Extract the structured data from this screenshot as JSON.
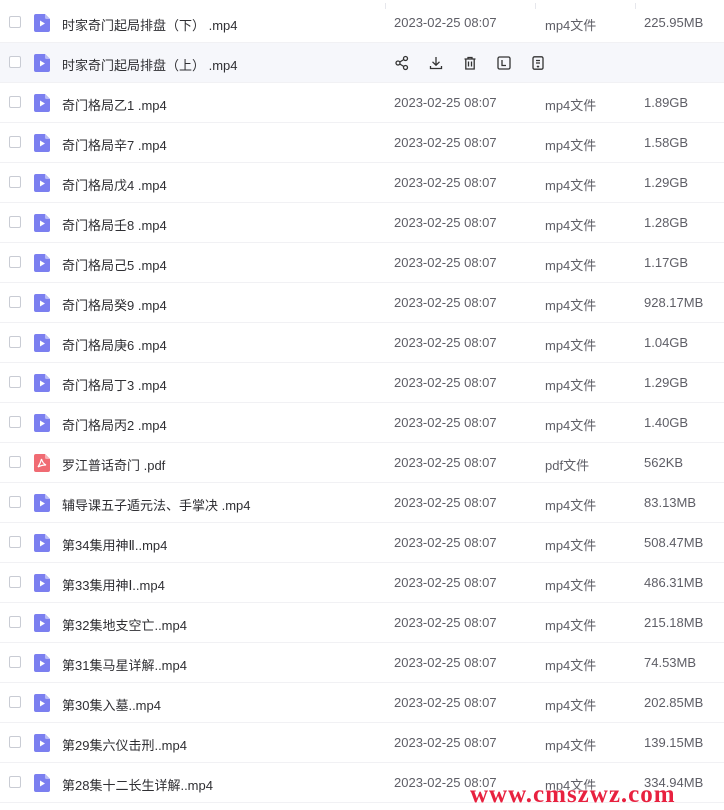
{
  "files": [
    {
      "name": "时家奇门起局排盘（下） .mp4",
      "date": "2023-02-25 08:07",
      "type": "mp4文件",
      "size": "225.95MB",
      "icon": "video-file-icon"
    },
    {
      "name": "时家奇门起局排盘（上） .mp4",
      "date": "",
      "type": "",
      "size": "",
      "icon": "video-file-icon",
      "hovered": true
    },
    {
      "name": "奇门格局乙1 .mp4",
      "date": "2023-02-25 08:07",
      "type": "mp4文件",
      "size": "1.89GB",
      "icon": "video-file-icon"
    },
    {
      "name": "奇门格局辛7 .mp4",
      "date": "2023-02-25 08:07",
      "type": "mp4文件",
      "size": "1.58GB",
      "icon": "video-file-icon"
    },
    {
      "name": "奇门格局戊4 .mp4",
      "date": "2023-02-25 08:07",
      "type": "mp4文件",
      "size": "1.29GB",
      "icon": "video-file-icon"
    },
    {
      "name": "奇门格局壬8 .mp4",
      "date": "2023-02-25 08:07",
      "type": "mp4文件",
      "size": "1.28GB",
      "icon": "video-file-icon"
    },
    {
      "name": "奇门格局己5 .mp4",
      "date": "2023-02-25 08:07",
      "type": "mp4文件",
      "size": "1.17GB",
      "icon": "video-file-icon"
    },
    {
      "name": "奇门格局癸9 .mp4",
      "date": "2023-02-25 08:07",
      "type": "mp4文件",
      "size": "928.17MB",
      "icon": "video-file-icon"
    },
    {
      "name": "奇门格局庚6 .mp4",
      "date": "2023-02-25 08:07",
      "type": "mp4文件",
      "size": "1.04GB",
      "icon": "video-file-icon"
    },
    {
      "name": "奇门格局丁3 .mp4",
      "date": "2023-02-25 08:07",
      "type": "mp4文件",
      "size": "1.29GB",
      "icon": "video-file-icon"
    },
    {
      "name": "奇门格局丙2 .mp4",
      "date": "2023-02-25 08:07",
      "type": "mp4文件",
      "size": "1.40GB",
      "icon": "video-file-icon"
    },
    {
      "name": "罗江普话奇门 .pdf",
      "date": "2023-02-25 08:07",
      "type": "pdf文件",
      "size": "562KB",
      "icon": "pdf-file-icon"
    },
    {
      "name": "辅导课五子遁元法、手掌决 .mp4",
      "date": "2023-02-25 08:07",
      "type": "mp4文件",
      "size": "83.13MB",
      "icon": "video-file-icon"
    },
    {
      "name": "第34集用神Ⅱ..mp4",
      "date": "2023-02-25 08:07",
      "type": "mp4文件",
      "size": "508.47MB",
      "icon": "video-file-icon"
    },
    {
      "name": "第33集用神Ⅰ..mp4",
      "date": "2023-02-25 08:07",
      "type": "mp4文件",
      "size": "486.31MB",
      "icon": "video-file-icon"
    },
    {
      "name": "第32集地支空亡..mp4",
      "date": "2023-02-25 08:07",
      "type": "mp4文件",
      "size": "215.18MB",
      "icon": "video-file-icon"
    },
    {
      "name": "第31集马星详解..mp4",
      "date": "2023-02-25 08:07",
      "type": "mp4文件",
      "size": "74.53MB",
      "icon": "video-file-icon"
    },
    {
      "name": "第30集入墓..mp4",
      "date": "2023-02-25 08:07",
      "type": "mp4文件",
      "size": "202.85MB",
      "icon": "video-file-icon"
    },
    {
      "name": "第29集六仪击刑..mp4",
      "date": "2023-02-25 08:07",
      "type": "mp4文件",
      "size": "139.15MB",
      "icon": "video-file-icon"
    },
    {
      "name": "第28集十二长生详解..mp4",
      "date": "2023-02-25 08:07",
      "type": "mp4文件",
      "size": "334.94MB",
      "icon": "video-file-icon"
    }
  ],
  "hover_actions": [
    {
      "icon": "share-icon"
    },
    {
      "icon": "download-icon"
    },
    {
      "icon": "delete-icon"
    },
    {
      "icon": "rename-icon"
    },
    {
      "icon": "more-icon"
    }
  ],
  "colors": {
    "video_icon": "#7b7ff0",
    "pdf_icon": "#f06b73",
    "row_hover": "#f6f7fb",
    "watermark": "#e8213f"
  },
  "watermark": "www.cmszwz.com"
}
